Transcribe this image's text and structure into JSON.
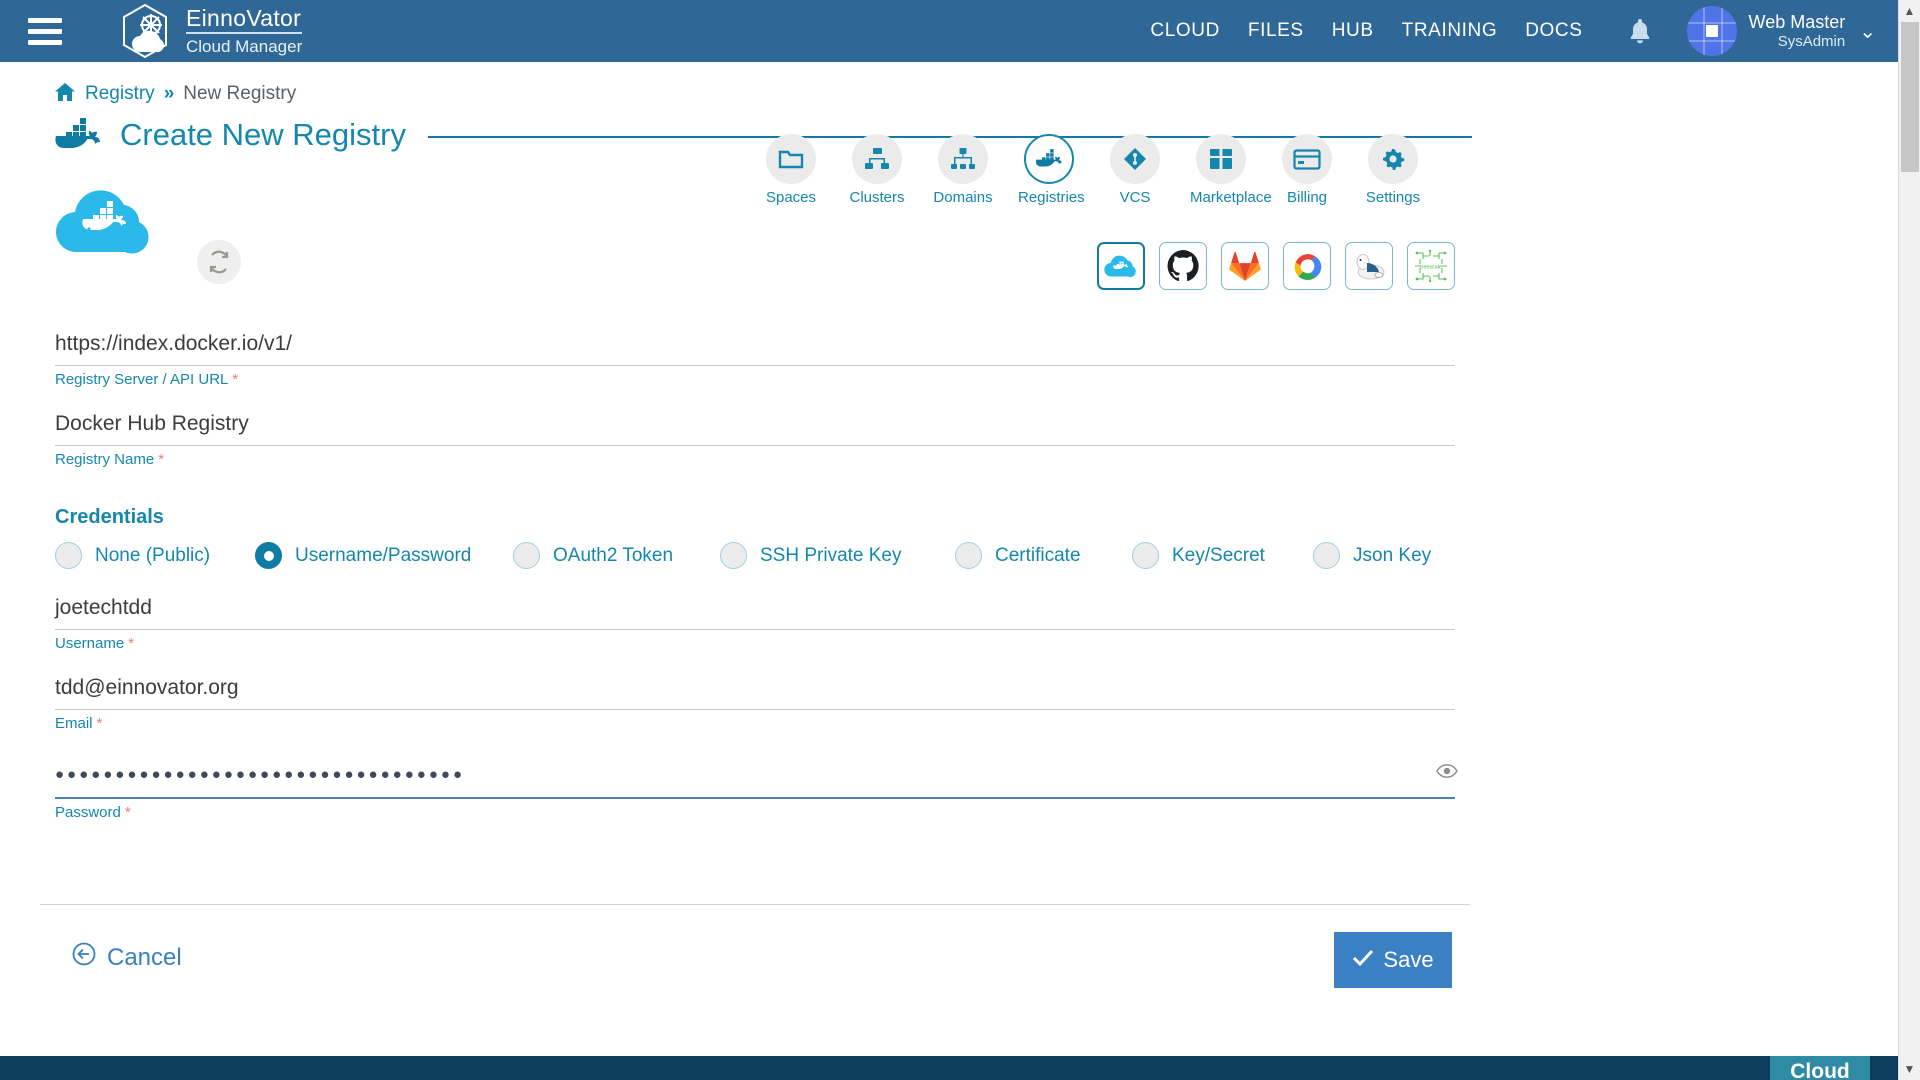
{
  "brand": {
    "name": "EinnoVator",
    "subtitle": "Cloud Manager",
    "logo_icon": "cloud-helm-hexagon-icon"
  },
  "topnav": {
    "menu_icon": "hamburger-menu-icon",
    "links": [
      {
        "label": "CLOUD"
      },
      {
        "label": "FILES"
      },
      {
        "label": "HUB"
      },
      {
        "label": "TRAINING"
      },
      {
        "label": "DOCS"
      }
    ],
    "bell_icon": "notification-bell-icon",
    "user": {
      "name": "Web Master",
      "role": "SysAdmin",
      "avatar_icon": "user-avatar-icon",
      "caret_icon": "chevron-down-icon"
    }
  },
  "breadcrumb": {
    "home_icon": "home-icon",
    "root": "Registry",
    "separator": "»",
    "current": "New Registry"
  },
  "page": {
    "title": "Create New Registry",
    "title_icon": "docker-whale-icon"
  },
  "iconnav": {
    "items": [
      {
        "label": "Spaces",
        "icon": "folder-icon",
        "active": false
      },
      {
        "label": "Clusters",
        "icon": "cluster-nodes-icon",
        "active": false
      },
      {
        "label": "Domains",
        "icon": "sitemap-icon",
        "active": false
      },
      {
        "label": "Registries",
        "icon": "docker-whale-icon",
        "active": true
      },
      {
        "label": "VCS",
        "icon": "git-branch-diamond-icon",
        "active": false
      },
      {
        "label": "Marketplace",
        "icon": "package-box-icon",
        "active": false
      },
      {
        "label": "Billing",
        "icon": "credit-card-icon",
        "active": false
      },
      {
        "label": "Settings",
        "icon": "gear-icon",
        "active": false
      }
    ]
  },
  "form": {
    "logo_icon": "docker-cloud-logo-icon",
    "refresh_icon": "refresh-icon",
    "providers": [
      {
        "name": "Docker Hub",
        "icon": "docker-cloud-icon",
        "selected": true
      },
      {
        "name": "GitHub",
        "icon": "github-icon",
        "selected": false
      },
      {
        "name": "GitLab",
        "icon": "gitlab-icon",
        "selected": false
      },
      {
        "name": "Google Cloud",
        "icon": "google-cloud-icon",
        "selected": false
      },
      {
        "name": "Quay",
        "icon": "quay-polarbear-icon",
        "selected": false
      },
      {
        "name": "Treescale",
        "icon": "treescale-icon",
        "selected": false
      }
    ],
    "url": {
      "value": "https://index.docker.io/v1/",
      "label": "Registry Server / API URL",
      "required": true
    },
    "name": {
      "value": "Docker Hub Registry",
      "label": "Registry Name",
      "required": true
    },
    "credentials_title": "Credentials",
    "credential_options": [
      {
        "label": "None (Public)",
        "selected": false
      },
      {
        "label": "Username/Password",
        "selected": true
      },
      {
        "label": "OAuth2 Token",
        "selected": false
      },
      {
        "label": "SSH Private Key",
        "selected": false
      },
      {
        "label": "Certificate",
        "selected": false
      },
      {
        "label": "Key/Secret",
        "selected": false
      },
      {
        "label": "Json Key",
        "selected": false
      }
    ],
    "username": {
      "value": "joetechtdd",
      "label": "Username",
      "required": true
    },
    "email": {
      "value": "tdd@einnovator.org",
      "label": "Email",
      "required": true
    },
    "password": {
      "value": "●●●●●●●●●●●●●●●●●●●●●●●●●●●●●●●●●●",
      "label": "Password",
      "required": true,
      "toggle_icon": "eye-icon"
    },
    "required_marker": "*"
  },
  "actions": {
    "cancel": {
      "label": "Cancel",
      "icon": "arrow-left-circle-icon"
    },
    "save": {
      "label": "Save",
      "icon": "check-icon"
    }
  },
  "footer": {
    "tab_label": "Cloud"
  },
  "colors": {
    "topbar": "#2f6897",
    "accent": "#1587ad",
    "accent_dark": "#0f7ba3",
    "save_button": "#3a80c2",
    "required": "#ef7b72",
    "footer_dark": "#0c3d5c",
    "footer_teal": "#2f8aa5"
  }
}
